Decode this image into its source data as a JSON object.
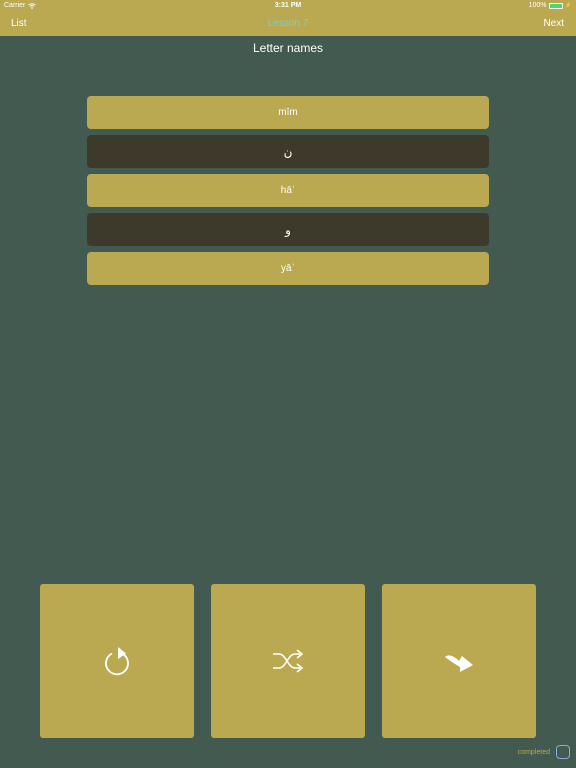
{
  "status_bar": {
    "carrier": "Carrier",
    "time": "3:31 PM",
    "battery": "100%",
    "battery_level": 1.0
  },
  "nav": {
    "left_label": "List",
    "title": "Lesson 7",
    "right_label": "Next"
  },
  "section_title": "Letter names",
  "answers": [
    {
      "label": "mīm",
      "style": "light"
    },
    {
      "label": "ن",
      "style": "dark"
    },
    {
      "label": "hāʾ",
      "style": "light"
    },
    {
      "label": "و",
      "style": "dark"
    },
    {
      "label": "yāʾ",
      "style": "light"
    }
  ],
  "controls": {
    "icons": [
      "replay-icon",
      "shuffle-icon",
      "forward-icon"
    ]
  },
  "completed": {
    "label": "completed",
    "checked": false
  },
  "colors": {
    "background": "#425a50",
    "accent": "#baa951",
    "dark_card": "#3d3a2c",
    "nav_title": "#6fd1e0",
    "battery": "#4cd964"
  }
}
